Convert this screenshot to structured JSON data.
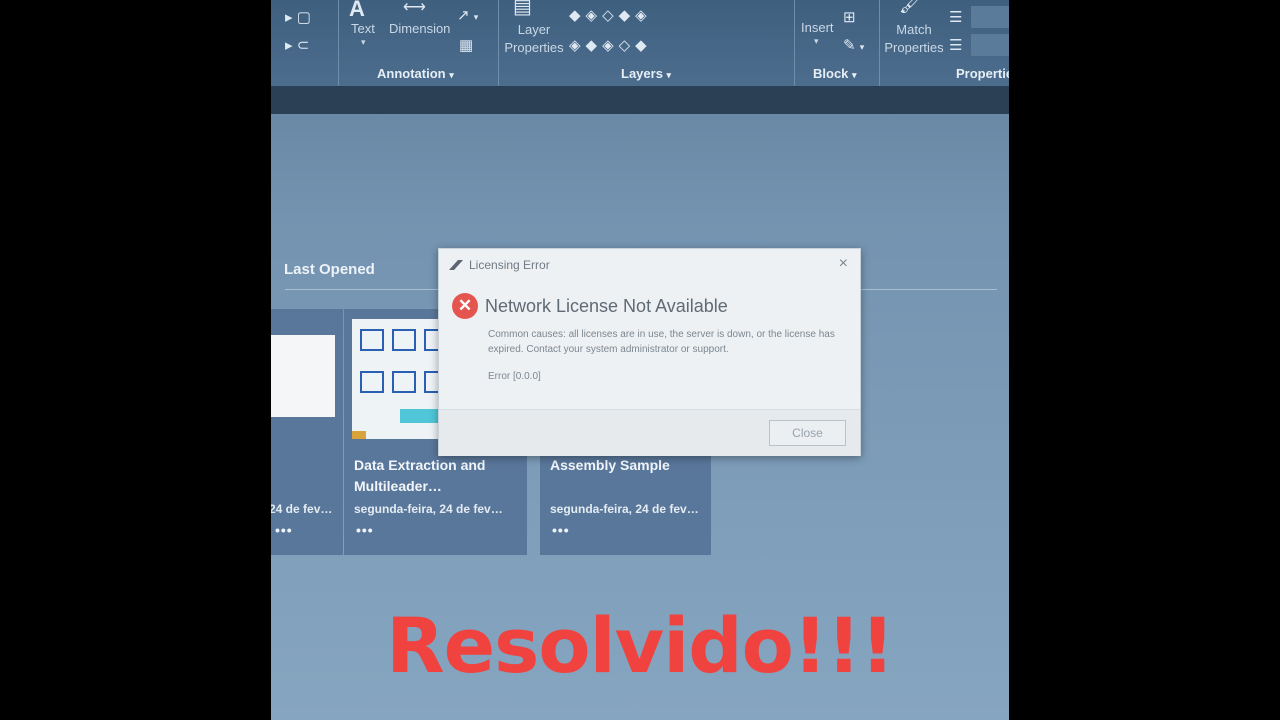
{
  "ribbon": {
    "annotation": {
      "text_label": "Text",
      "dimension_label": "Dimension",
      "panel_title": "Annotation"
    },
    "layers": {
      "layer_properties_label": "Layer Properties",
      "panel_title": "Layers"
    },
    "block": {
      "insert_label": "Insert",
      "panel_title": "Block"
    },
    "properties": {
      "match_properties_label": "Match Properties",
      "panel_title": "Propertie"
    }
  },
  "start_page": {
    "section_title": "Last Opened",
    "cards": [
      {
        "title": "",
        "date": "24 de fev…"
      },
      {
        "title": "Data Extraction and Multileader…",
        "date": "segunda-feira, 24 de fev…"
      },
      {
        "title": "Assembly Sample",
        "date": "segunda-feira, 24 de fev…"
      }
    ],
    "more_label": "•••"
  },
  "dialog": {
    "title": "Licensing Error",
    "close_glyph": "×",
    "error_glyph": "✕",
    "heading": "Network License Not Available",
    "message": "Common causes: all licenses are in use, the server is down, or the license has expired. Contact your system administrator or support.",
    "error_code": "Error [0.0.0]",
    "close_button": "Close"
  },
  "overlay_text": "Resolvido!!!",
  "colors": {
    "overlay": "#f0433f",
    "error_icon": "#e55550",
    "ribbon": "#4c6d8d"
  }
}
